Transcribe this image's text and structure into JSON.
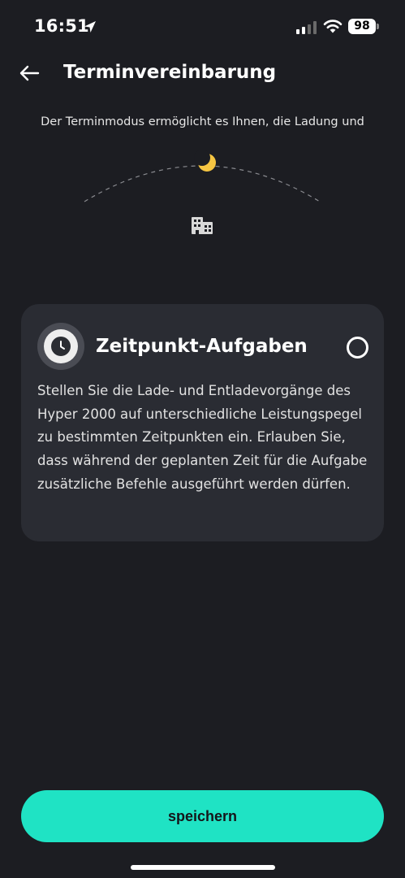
{
  "status_bar": {
    "time": "16:51",
    "battery": "98"
  },
  "header": {
    "title": "Terminvereinbarung"
  },
  "intro": {
    "text": "Der Terminmodus ermöglicht es Ihnen, die Ladung und"
  },
  "card": {
    "title": "Zeitpunkt-Aufgaben",
    "description": "Stellen Sie die Lade- und Entladevorgänge des Hyper 2000 auf unterschiedliche Leistungspegel zu bestimmten Zeitpunkten ein. Erlauben Sie, dass während der geplanten Zeit für die Aufgabe zusätzliche Befehle ausgeführt werden dürfen.",
    "selected": false
  },
  "actions": {
    "save_label": "speichern"
  },
  "colors": {
    "background": "#1c1d22",
    "card": "#2a2c33",
    "accent": "#1fe3c4",
    "moon": "#f5c542"
  },
  "icons": {
    "back": "arrow-left-icon",
    "moon": "moon-icon",
    "building": "building-icon",
    "clock": "clock-icon"
  }
}
